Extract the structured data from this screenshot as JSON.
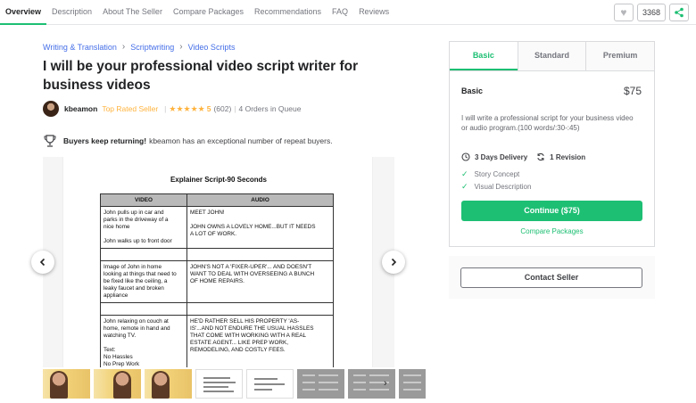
{
  "nav": {
    "tabs": [
      "Overview",
      "Description",
      "About The Seller",
      "Compare Packages",
      "Recommendations",
      "FAQ",
      "Reviews"
    ],
    "active_tab": "Overview",
    "like_count": "3368"
  },
  "breadcrumb": [
    "Writing & Translation",
    "Scriptwriting",
    "Video Scripts"
  ],
  "gig": {
    "title": "I will be your professional video script writer for business videos"
  },
  "seller": {
    "name": "kbeamon",
    "level": "Top Rated Seller",
    "rating": "5",
    "stars": 5,
    "reviews": "(602)",
    "queue": "4 Orders in Queue"
  },
  "repeat": {
    "bold": "Buyers keep returning!",
    "rest": "kbeamon has an exceptional number of repeat buyers."
  },
  "gallery": {
    "doc_title": "Explainer Script-90 Seconds",
    "headers": [
      "VIDEO",
      "AUDIO"
    ],
    "rows": [
      {
        "video": [
          "John pulls up in car and",
          "parks in the driveway of a",
          "nice home",
          "",
          "John walks up to front door"
        ],
        "audio": [
          "MEET JOHN!",
          "",
          "JOHN OWNS A LOVELY HOME...BUT IT NEEDS",
          "A LOT OF WORK."
        ]
      },
      {
        "video": [],
        "audio": []
      },
      {
        "video": [
          "Image of John in home",
          "looking at things that need to",
          "be fixed like the ceiling, a",
          "leaky faucet and broken",
          "appliance"
        ],
        "audio": [
          "JOHN'S NOT A 'FIXER-UPER'... AND DOESN'T",
          "WANT TO DEAL WITH OVERSEEING A BUNCH",
          "OF HOME REPAIRS."
        ]
      },
      {
        "video": [],
        "audio": []
      },
      {
        "video": [
          "John relaxing on couch at",
          "home, remote in hand and",
          "watching TV.",
          "",
          "Text:",
          "No Hassles",
          "No Prep Work"
        ],
        "audio": [
          "HE'D RATHER SELL HIS PROPERTY 'AS-",
          "IS'...AND NOT ENDURE THE USUAL HASSLES",
          "THAT COME WITH WORKING WITH A REAL",
          "ESTATE AGENT... LIKE PREP WORK,",
          "REMODELING, AND COSTLY FEES."
        ]
      }
    ]
  },
  "package": {
    "tabs": [
      "Basic",
      "Standard",
      "Premium"
    ],
    "active_tab": "Basic",
    "name": "Basic",
    "price": "$75",
    "description": "I will write a professional script for your business video or audio program.(100 words/:30-:45)",
    "delivery": "3 Days Delivery",
    "revisions": "1 Revision",
    "features": [
      "Story Concept",
      "Visual Description"
    ],
    "continue_label": "Continue ($75)",
    "compare_label": "Compare Packages"
  },
  "contact": {
    "label": "Contact Seller"
  },
  "colors": {
    "accent": "#1dbf73",
    "link": "#446ee7",
    "star": "#ffb33e"
  }
}
